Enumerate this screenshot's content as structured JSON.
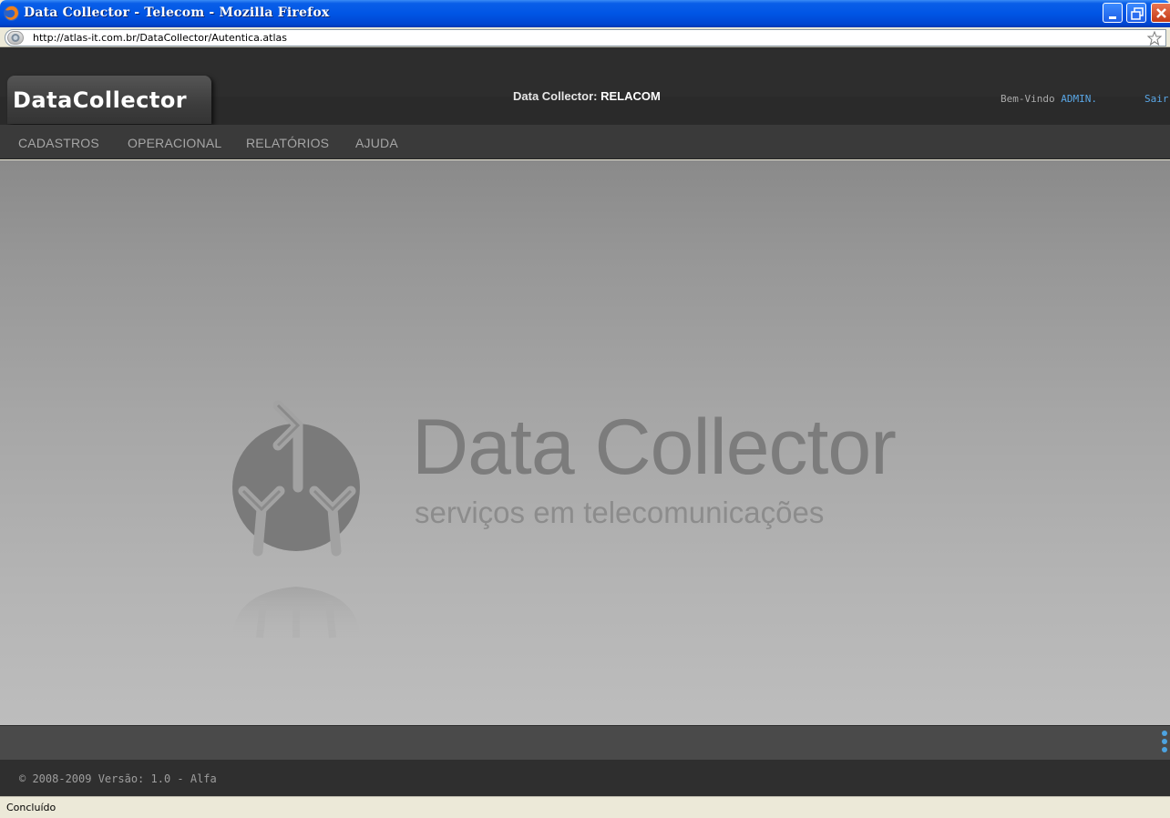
{
  "window": {
    "title": "Data Collector - Telecom - Mozilla Firefox"
  },
  "browser": {
    "url": "http://atlas-it.com.br/DataCollector/Autentica.atlas",
    "status": "Concluído"
  },
  "header": {
    "brand": "DataCollector",
    "center_label": "Data Collector:",
    "center_value": "RELACOM",
    "welcome_label": "Bem-Vindo",
    "user": "ADMIN.",
    "logout": "Sair"
  },
  "menu": {
    "items": [
      {
        "label": "CADASTROS"
      },
      {
        "label": "OPERACIONAL"
      },
      {
        "label": "RELATÓRIOS"
      },
      {
        "label": "AJUDA"
      }
    ]
  },
  "content": {
    "logo_title": "Data Collector",
    "logo_subtitle": "serviços em telecomunicações"
  },
  "footer": {
    "text": "© 2008-2009 Versão: 1.0 - Alfa"
  },
  "colors": {
    "title_bar": "#0055e5",
    "header_bg": "#2d2d2d",
    "accent_link": "#5aa7e6",
    "content_bg": "#a6a6a6"
  }
}
